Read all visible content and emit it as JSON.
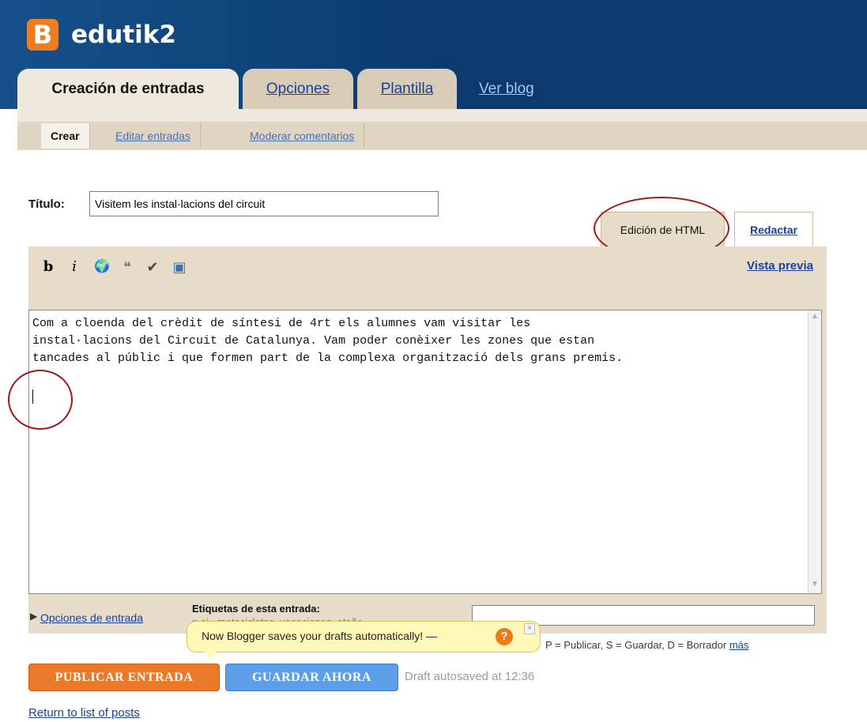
{
  "colors": {
    "header_bg": "#0c3a6e",
    "tab_bg": "#d8ccb6",
    "panel_bg": "#e6dcc9",
    "accent_orange": "#ea7a2a",
    "accent_blue": "#5c9fe7",
    "highlight_red": "#a01818",
    "tooltip_bg": "#fff9b8"
  },
  "header": {
    "logo_glyph": "B",
    "logo_icon": "blogger-logo-icon",
    "blog_name": "edutik2"
  },
  "tabs": [
    {
      "label": "Creación de entradas",
      "active": true
    },
    {
      "label": "Opciones",
      "active": false
    },
    {
      "label": "Plantilla",
      "active": false
    },
    {
      "label": "Ver blog",
      "active": false
    }
  ],
  "subnav": [
    {
      "label": "Crear",
      "active": true
    },
    {
      "label": "Editar entradas",
      "active": false
    },
    {
      "label": "Moderar comentarios",
      "active": false
    }
  ],
  "post": {
    "title_label": "Título:",
    "title_value": "Visitem les instal·lacions del circuit",
    "body_lines": [
      "Com a cloenda del crèdit de síntesi de 4rt els alumnes vam visitar les",
      "instal·lacions del Circuit de Catalunya. Vam poder conèixer les zones que estan",
      "tancades al públic i que formen part de la complexa organització dels grans premis."
    ]
  },
  "editor": {
    "mode_tabs": [
      {
        "label": "Edición de HTML",
        "active": true
      },
      {
        "label": "Redactar",
        "active": false
      }
    ],
    "toolbar": [
      {
        "icon": "bold-icon",
        "glyph": "b"
      },
      {
        "icon": "italic-icon",
        "glyph": "i"
      },
      {
        "icon": "link-icon",
        "glyph": "🌍"
      },
      {
        "icon": "blockquote-icon",
        "glyph": "❝"
      },
      {
        "icon": "spellcheck-icon",
        "glyph": "✔"
      },
      {
        "icon": "image-icon",
        "glyph": "▣"
      }
    ],
    "preview_label": "Vista previa"
  },
  "post_options": {
    "options_link": "Opciones de entrada",
    "labels_heading": "Etiquetas de esta entrada:",
    "labels_hint": "p.ej., motocicletas, vacaciones, otoño",
    "labels_value": "",
    "shortcuts_text": "P = Publicar, S = Guardar, D = Borrador",
    "shortcuts_more": "más"
  },
  "tooltip": {
    "text": "Now Blogger saves your drafts automatically! —",
    "help_icon": "help-icon",
    "help_glyph": "?",
    "close_icon": "close-icon",
    "close_glyph": "×"
  },
  "actions": {
    "publish_label": "PUBLICAR ENTRADA",
    "save_label": "GUARDAR AHORA",
    "autosave_status": "Draft autosaved at 12:36",
    "return_link": "Return to list of posts"
  }
}
